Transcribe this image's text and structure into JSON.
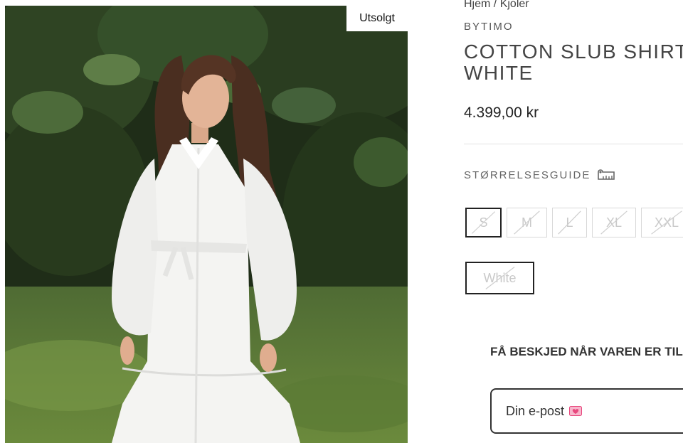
{
  "breadcrumb": {
    "home": "Hjem",
    "separator": "/",
    "category": "Kjoler"
  },
  "product": {
    "brand": "BYTIMO",
    "title": "COTTON SLUB SHIRT\nWHITE",
    "price": "4.399,00 kr",
    "badge": "Utsolgt"
  },
  "size_guide": {
    "label": "STØRRELSESGUIDE",
    "icon": "ruler-icon"
  },
  "sizes": {
    "selected": "S",
    "options": [
      "S",
      "M",
      "L",
      "XL",
      "XXL"
    ],
    "all_unavailable": true
  },
  "color": {
    "selected": "White",
    "unavailable": true
  },
  "notify": {
    "heading": "FÅ BESKJED NÅR VAREN ER TIL",
    "email_placeholder": "Din e-post",
    "email_icon": "heart-letter-icon"
  },
  "colors": {
    "accent_pink": "#e8487e",
    "border_dark": "#222222"
  }
}
